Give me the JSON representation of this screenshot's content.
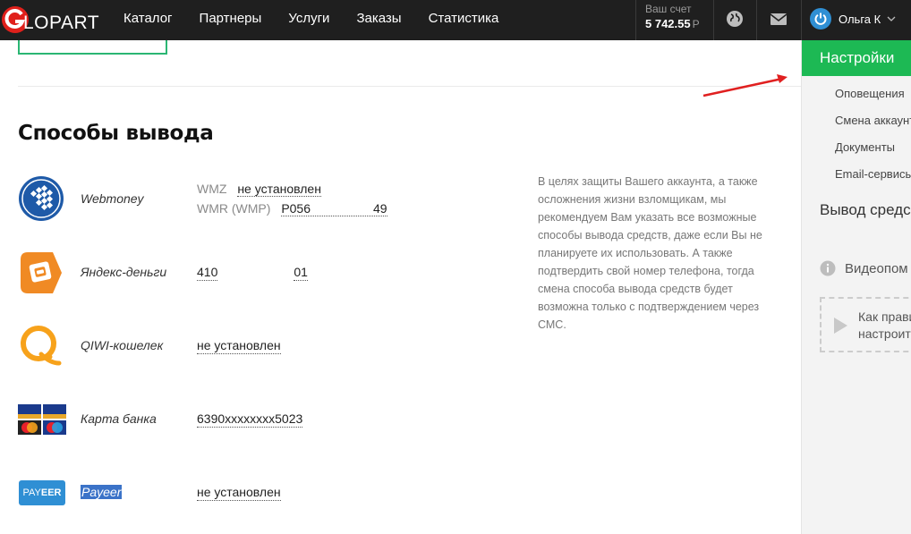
{
  "logo": {
    "letter": "G",
    "text": "LOPART"
  },
  "nav": [
    {
      "label": "Каталог"
    },
    {
      "label": "Партнеры"
    },
    {
      "label": "Услуги"
    },
    {
      "label": "Заказы"
    },
    {
      "label": "Статистика"
    }
  ],
  "account": {
    "label": "Ваш счет",
    "value": "5 742.55",
    "currency": "Р"
  },
  "user": {
    "name": "Ольга К"
  },
  "section_title": "Способы вывода",
  "methods": {
    "webmoney": {
      "name": "Webmoney",
      "wmz_label": "WMZ",
      "wmz_value": "не установлен",
      "wmr_label": "WMR (WMP)",
      "wmr_value_start": "P056",
      "wmr_value_end": "49"
    },
    "yandex": {
      "name": "Яндекс-деньги",
      "value_start": "410",
      "value_end": "01"
    },
    "qiwi": {
      "name": "QIWI-кошелек",
      "value": "не установлен"
    },
    "card": {
      "name": "Карта банка",
      "value": "6390xxxxxxxx5023"
    },
    "payeer": {
      "name": "Payeer",
      "logo_text_a": "PAY",
      "logo_text_b": "EER",
      "value": "не установлен"
    }
  },
  "note": "В целях защиты Вашего аккаунта, а также осложнения жизни взломщикам, мы рекомендуем Вам указать все возможные способы вывода средств, даже если Вы не планируете их использовать. А также подтвердить свой номер телефона, тогда смена способа вывода средств будет возможна только с подтверждением через СМС.",
  "sidebar": {
    "active": "Настройки",
    "items": [
      {
        "label": "Оповещения"
      },
      {
        "label": "Смена аккаунт"
      },
      {
        "label": "Документы"
      },
      {
        "label": "Email-сервисы"
      }
    ],
    "heading": "Вывод средс",
    "info": "Видеопом",
    "video_line1": "Как прави",
    "video_line2": "настроить"
  },
  "colors": {
    "accent_green": "#1db954",
    "topbar": "#1f1f1f",
    "arrow": "#e02020",
    "logo_red": "#e0201b"
  }
}
